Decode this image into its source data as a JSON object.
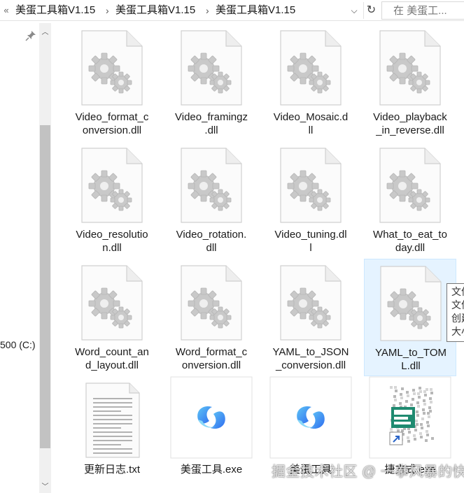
{
  "address_bar": {
    "overflow_icon": "double-chevron-left-icon",
    "breadcrumbs": [
      "美蛋工具箱V1.15",
      "美蛋工具箱V1.15",
      "美蛋工具箱V1.15"
    ],
    "search_placeholder": "在 美蛋工..."
  },
  "nav_pane": {
    "drive_label": "500 (C:)"
  },
  "files": [
    {
      "label": "Video_format_c\nonversion.dll",
      "type": "dll"
    },
    {
      "label": "Video_framingz\n.dll",
      "type": "dll"
    },
    {
      "label": "Video_Mosaic.d\nll",
      "type": "dll"
    },
    {
      "label": "Video_playback\n_in_reverse.dll",
      "type": "dll"
    },
    {
      "label": "Video_resolutio\nn.dll",
      "type": "dll"
    },
    {
      "label": "Video_rotation.\ndll",
      "type": "dll"
    },
    {
      "label": "Video_tuning.dl\nl",
      "type": "dll"
    },
    {
      "label": "What_to_eat_to\nday.dll",
      "type": "dll"
    },
    {
      "label": "Word_count_an\nd_layout.dll",
      "type": "dll"
    },
    {
      "label": "Word_format_c\nonversion.dll",
      "type": "dll"
    },
    {
      "label": "YAML_to_JSON\n_conversion.dll",
      "type": "dll"
    },
    {
      "label": "YAML_to_TOM\nL.dll",
      "type": "dll",
      "selected": true
    },
    {
      "label": "更新日志.txt",
      "type": "txt"
    },
    {
      "label": "美蛋工具.exe",
      "type": "exe"
    },
    {
      "label": "美蛋工具",
      "type": "exe"
    },
    {
      "label": "捷方式.exe",
      "type": "shortcut"
    }
  ],
  "tooltip": {
    "lines": [
      "文件",
      "文件",
      "创建",
      "大小"
    ]
  },
  "watermark": "掘金技术社区 @ 一拳风暴的快",
  "colors": {
    "selection_bg": "#e5f3ff",
    "selection_border": "#cde8ff",
    "scroll_thumb": "#c2c2c2",
    "exe_logo_blue": "#2f6cf0",
    "exe_logo_cyan": "#5fc6f5",
    "shortcut_green": "#1f8a70"
  }
}
